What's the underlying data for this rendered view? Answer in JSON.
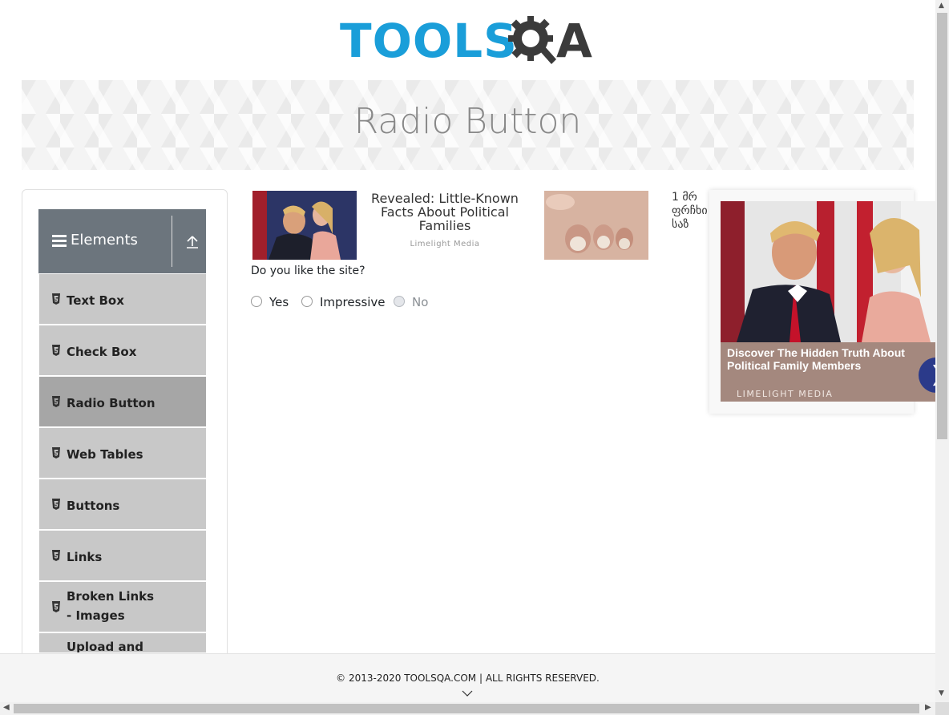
{
  "header": {
    "logo_text_primary": "TOOLS",
    "logo_text_secondary": "A",
    "logo_icon": "gear-q-magnifier-icon"
  },
  "banner": {
    "title": "Radio Button"
  },
  "sidebar": {
    "group_title": "Elements",
    "group_icon": "hamburger-icon",
    "collapse_icon": "upload-arrow-icon",
    "items": [
      {
        "label": "Text Box",
        "icon": "html5-icon"
      },
      {
        "label": "Check Box",
        "icon": "html5-icon"
      },
      {
        "label": "Radio Button",
        "icon": "html5-icon",
        "active": true
      },
      {
        "label": "Web Tables",
        "icon": "html5-icon"
      },
      {
        "label": "Buttons",
        "icon": "html5-icon"
      },
      {
        "label": "Links",
        "icon": "html5-icon"
      },
      {
        "label": "Broken Links - Images",
        "icon": "html5-icon"
      },
      {
        "label": "Upload and",
        "icon": "html5-icon"
      }
    ]
  },
  "ads": {
    "ad1": {
      "title": "Revealed: Little-Known Facts About Political Families",
      "source": "Limelight Media"
    },
    "ad2": {
      "text": "1 მრ ფრჩხი საზ"
    },
    "floating": {
      "headline": "Discover The Hidden Truth About Political Family Members",
      "source": "LIMELIGHT MEDIA",
      "next_icon": "chevron-right-icon"
    }
  },
  "main": {
    "question": "Do you like the site?",
    "options": [
      {
        "label": "Yes",
        "disabled": false
      },
      {
        "label": "Impressive",
        "disabled": false
      },
      {
        "label": "No",
        "disabled": true
      }
    ]
  },
  "footer": {
    "copyright": "© 2013-2020 TOOLSQA.COM | ALL RIGHTS RESERVED."
  },
  "colors": {
    "brand_blue": "#1a9ed9",
    "brand_dark": "#3b3b3b",
    "sidebar_header": "#6c757d",
    "menu_item": "#c8c8c8",
    "menu_item_active": "#a6a6a6"
  }
}
